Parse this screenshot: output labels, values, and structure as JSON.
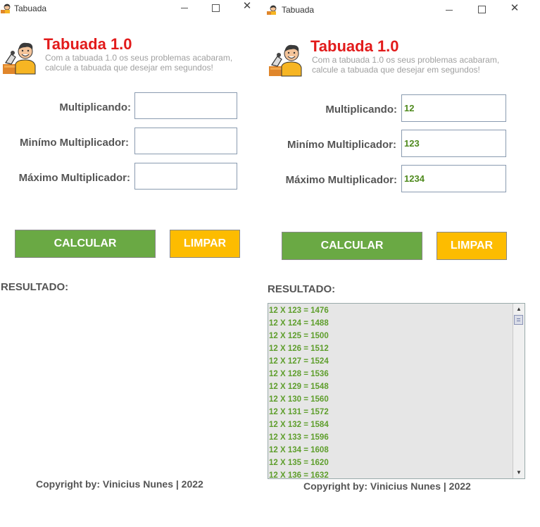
{
  "windows": [
    {
      "title": "Tabuada",
      "app_title": "Tabuada 1.0",
      "subtitle_line1": "Com a tabuada 1.0 os seus problemas acabaram,",
      "subtitle_line2": "calcule a tabuada que desejar em segundos!",
      "labels": {
        "multiplicand": "Multiplicando:",
        "min": "Minímo Multiplicador:",
        "max": "Máximo Multiplicador:"
      },
      "values": {
        "multiplicand": "",
        "min": "",
        "max": ""
      },
      "buttons": {
        "calculate": "CALCULAR",
        "clear": "LIMPAR"
      },
      "result_label": "RESULTADO:",
      "copyright": "Copyright by: Vinicius Nunes | 2022"
    },
    {
      "title": "Tabuada",
      "app_title": "Tabuada 1.0",
      "subtitle_line1": "Com a tabuada 1.0 os seus problemas acabaram,",
      "subtitle_line2": "calcule a tabuada que desejar em segundos!",
      "labels": {
        "multiplicand": "Multiplicando:",
        "min": "Minímo Multiplicador:",
        "max": "Máximo Multiplicador:"
      },
      "values": {
        "multiplicand": "12",
        "min": "123",
        "max": "1234"
      },
      "buttons": {
        "calculate": "CALCULAR",
        "clear": "LIMPAR"
      },
      "result_label": "RESULTADO:",
      "results": [
        "12 X 123 = 1476",
        "12 X 124 = 1488",
        "12 X 125 = 1500",
        "12 X 126 = 1512",
        "12 X 127 = 1524",
        "12 X 128 = 1536",
        "12 X 129 = 1548",
        "12 X 130 = 1560",
        "12 X 131 = 1572",
        "12 X 132 = 1584",
        "12 X 133 = 1596",
        "12 X 134 = 1608",
        "12 X 135 = 1620",
        "12 X 136 = 1632"
      ],
      "copyright": "Copyright by: Vinicius Nunes | 2022"
    }
  ],
  "colors": {
    "title_red": "#e21b1b",
    "calc_green": "#6aa944",
    "clear_yellow": "#fdbc00",
    "result_green": "#5e9e2c"
  },
  "icons": {
    "window": "app-logo-icon",
    "minimize": "minimize-icon",
    "maximize": "maximize-icon",
    "close": "close-icon"
  }
}
